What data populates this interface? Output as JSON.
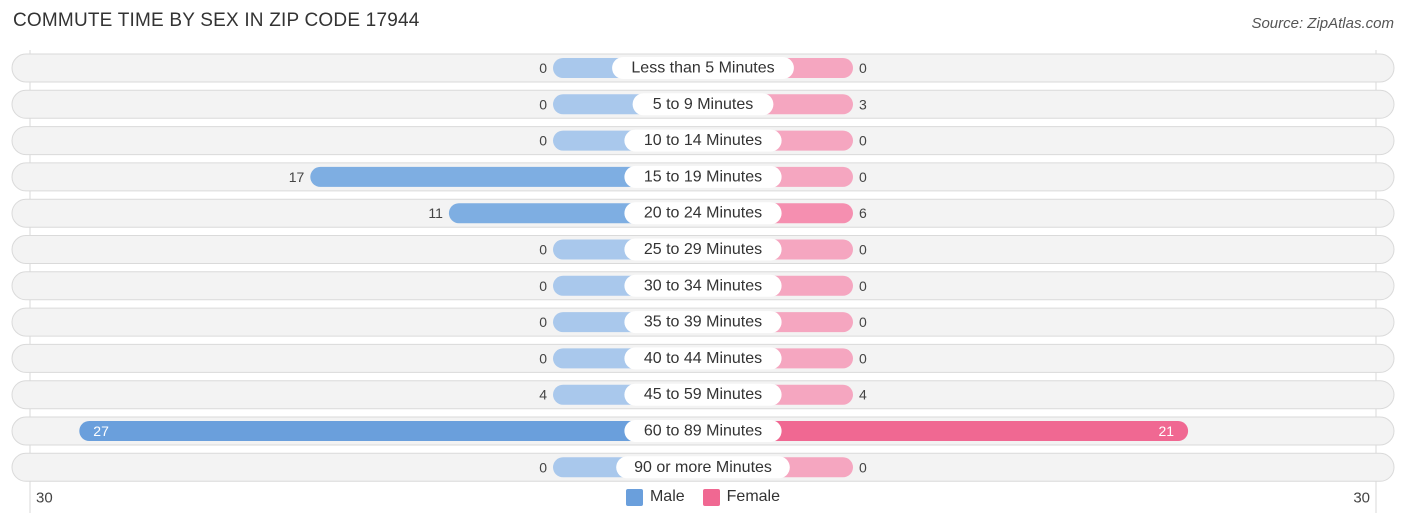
{
  "header": {
    "title": "COMMUTE TIME BY SEX IN ZIP CODE 17944",
    "source": "Source: ZipAtlas.com"
  },
  "legend": {
    "male_label": "Male",
    "female_label": "Female"
  },
  "colors": {
    "male": "#6a9fdc",
    "male_light": "#a9c8ec",
    "female": "#f06892",
    "female_light": "#f5a6c0",
    "row_bg": "#f3f3f3"
  },
  "chart_data": {
    "type": "bar",
    "orientation": "horizontal-diverging",
    "title": "COMMUTE TIME BY SEX IN ZIP CODE 17944",
    "xlabel": "",
    "ylabel": "",
    "axis_left_label": "30",
    "axis_right_label": "30",
    "xlim": [
      -30,
      30
    ],
    "legend_position": "bottom-center",
    "categories": [
      "Less than 5 Minutes",
      "5 to 9 Minutes",
      "10 to 14 Minutes",
      "15 to 19 Minutes",
      "20 to 24 Minutes",
      "25 to 29 Minutes",
      "30 to 34 Minutes",
      "35 to 39 Minutes",
      "40 to 44 Minutes",
      "45 to 59 Minutes",
      "60 to 89 Minutes",
      "90 or more Minutes"
    ],
    "series": [
      {
        "name": "Male",
        "values": [
          0,
          0,
          0,
          17,
          11,
          0,
          0,
          0,
          0,
          4,
          27,
          0
        ]
      },
      {
        "name": "Female",
        "values": [
          0,
          3,
          0,
          0,
          6,
          0,
          0,
          0,
          0,
          4,
          21,
          0
        ]
      }
    ]
  }
}
